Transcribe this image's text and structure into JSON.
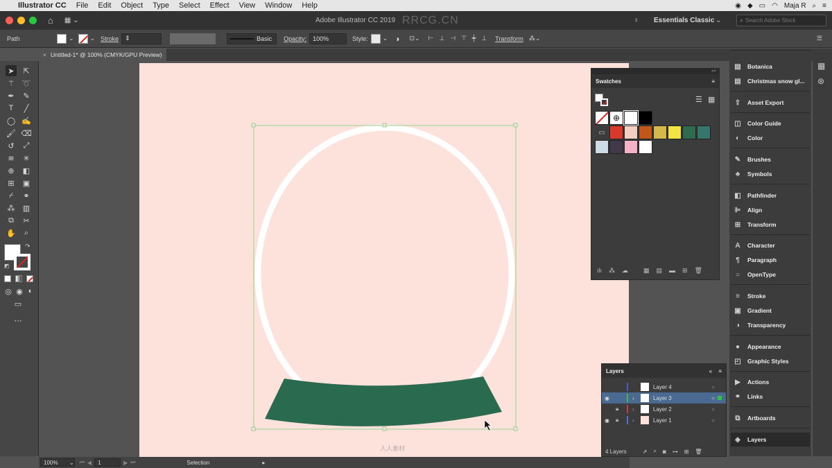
{
  "menubar": {
    "app": "Illustrator CC",
    "items": [
      "File",
      "Edit",
      "Object",
      "Type",
      "Select",
      "Effect",
      "View",
      "Window",
      "Help"
    ],
    "user": "Maja R"
  },
  "appbar": {
    "title": "Adobe Illustrator CC 2019",
    "workspace": "Essentials Classic",
    "search_placeholder": "Search Adobe Stock",
    "watermark": "RRCG.CN"
  },
  "control": {
    "selection_type": "Path",
    "stroke_label": "Stroke",
    "profile": "Basic",
    "opacity_label": "Opacity:",
    "opacity_value": "100%",
    "style_label": "Style:",
    "transform_label": "Transform"
  },
  "document": {
    "tab": "Untitled-1* @ 100% (CMYK/GPU Preview)"
  },
  "status": {
    "zoom": "100%",
    "artboard": "1",
    "tool": "Selection"
  },
  "swatches": {
    "title": "Swatches",
    "colors": [
      "#d9392a",
      "#f3cfc2",
      "#c0581c",
      "#d4b84a",
      "#f2e443",
      "#2e6b4f",
      "#36766c",
      "#ccdbe6",
      "#41394a",
      "#f4b2c8",
      "#ffffff"
    ]
  },
  "layers": {
    "title": "Layers",
    "count": "4 Layers",
    "rows": [
      {
        "name": "Layer 4",
        "color": "#4a5ad0"
      },
      {
        "name": "Layer 3",
        "color": "#33c241"
      },
      {
        "name": "Layer 2",
        "color": "#d13b3b"
      },
      {
        "name": "Layer 1",
        "color": "#5b6ad6"
      }
    ]
  },
  "dock": {
    "items": [
      "Botanica",
      "Christmas snow gl...",
      "Asset Export",
      "Color Guide",
      "Color",
      "Brushes",
      "Symbols",
      "Pathfinder",
      "Align",
      "Transform",
      "Character",
      "Paragraph",
      "OpenType",
      "Stroke",
      "Gradient",
      "Transparency",
      "Appearance",
      "Graphic Styles",
      "Actions",
      "Links",
      "Artboards",
      "Layers"
    ]
  },
  "colors": {
    "artboard": "#fde2db",
    "globe_base": "#2a6b4f",
    "selection": "#8fd18f"
  },
  "footer_watermark": "人人素材"
}
